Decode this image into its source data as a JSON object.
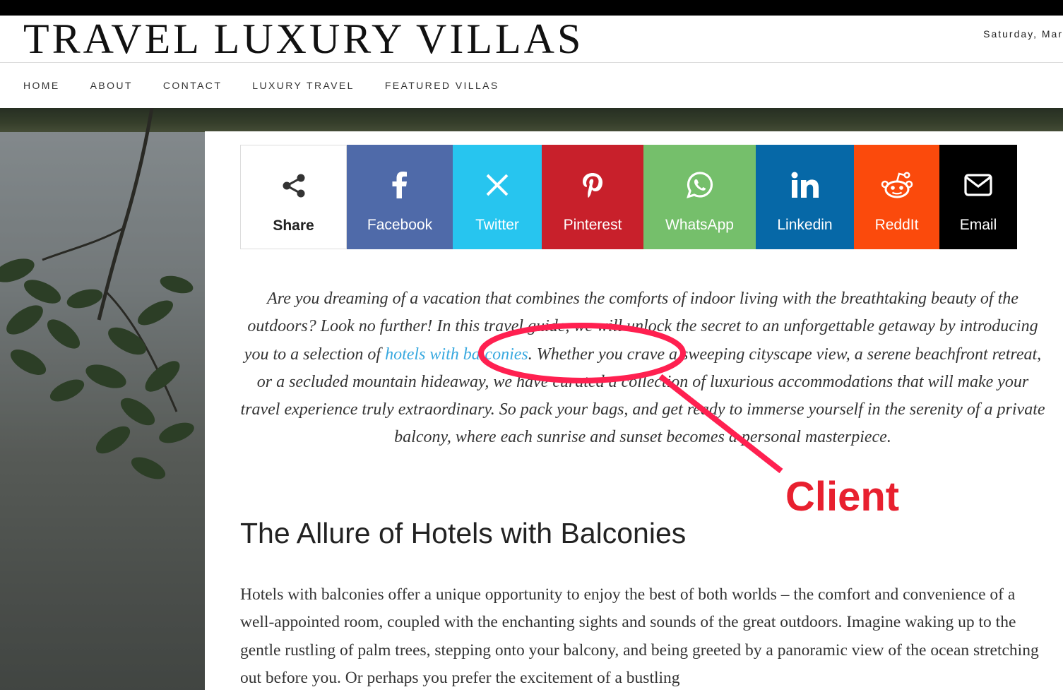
{
  "header": {
    "site_title": "TRAVEL LUXURY VILLAS",
    "date": "Saturday, Mar"
  },
  "nav": {
    "items": [
      "HOME",
      "ABOUT",
      "CONTACT",
      "LUXURY TRAVEL",
      "FEATURED VILLAS"
    ]
  },
  "share": {
    "items": [
      {
        "label": "Share",
        "icon": "share-icon",
        "color": "#ffffff"
      },
      {
        "label": "Facebook",
        "icon": "facebook-icon",
        "color": "#4f6aa9"
      },
      {
        "label": "Twitter",
        "icon": "x-icon",
        "color": "#27c5ef"
      },
      {
        "label": "Pinterest",
        "icon": "pinterest-icon",
        "color": "#c8202b"
      },
      {
        "label": "WhatsApp",
        "icon": "whatsapp-icon",
        "color": "#75bf6b"
      },
      {
        "label": "Linkedin",
        "icon": "linkedin-icon",
        "color": "#0668a7"
      },
      {
        "label": "ReddIt",
        "icon": "reddit-icon",
        "color": "#fb4a0c"
      },
      {
        "label": "Email",
        "icon": "email-icon",
        "color": "#000000"
      }
    ]
  },
  "article": {
    "intro_before": "Are you dreaming of a vacation that combines the comforts of indoor living with the breathtaking beauty of the outdoors? Look no further! In this travel guide, we will unlock the secret to an unforgettable getaway by introducing you to a selection of ",
    "intro_link": "hotels with balconies",
    "intro_after": ". Whether you crave a sweeping cityscape view, a serene beachfront retreat, or a secluded mountain hideaway, we have curated a collection of luxurious accommodations that will make your travel experience truly extraordinary. So pack your bags, and get ready to immerse yourself in the serenity of a private balcony, where each sunrise and sunset becomes a personal masterpiece.",
    "heading": "The Allure of Hotels with Balconies",
    "paragraph": "Hotels with balconies offer a unique opportunity to enjoy the best of both worlds – the comfort and convenience of a well-appointed room, coupled with the enchanting sights and sounds of the great outdoors. Imagine waking up to the gentle rustling of palm trees, stepping onto your balcony, and being greeted by a panoramic view of the ocean stretching out before you. Or perhaps you prefer the excitement of a bustling"
  },
  "annotation": {
    "label": "Client",
    "color": "#e8202f"
  }
}
